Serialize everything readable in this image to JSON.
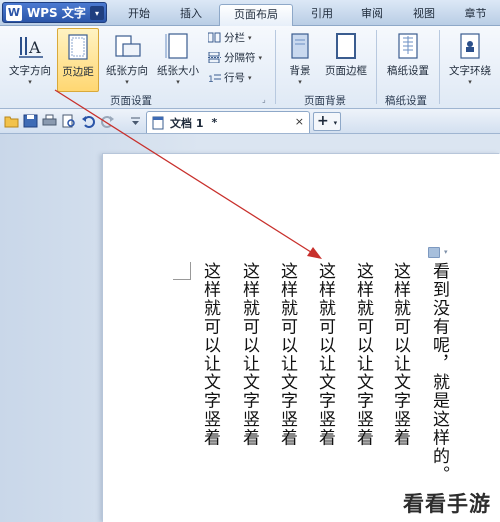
{
  "app": {
    "logo_text": "W",
    "name": "WPS 文字",
    "caret": "▾"
  },
  "tabs": [
    {
      "label": "开始"
    },
    {
      "label": "插入"
    },
    {
      "label": "页面布局"
    },
    {
      "label": "引用"
    },
    {
      "label": "审阅"
    },
    {
      "label": "视图"
    },
    {
      "label": "章节"
    }
  ],
  "active_tab": "页面布局",
  "ribbon": {
    "text_direction": "文字方向",
    "margins": "页边距",
    "orientation": "纸张方向",
    "paper_size": "纸张大小",
    "columns": "分栏",
    "breaks": "分隔符",
    "line_numbers": "行号",
    "background": "背景",
    "page_border": "页面边框",
    "manuscript_setup": "稿纸设置",
    "text_wrap": "文字环绕",
    "group_page_setup": "页面设置",
    "group_page_background": "页面背景",
    "group_manuscript": "稿纸设置",
    "caret": "▾"
  },
  "document_tab": {
    "name": "文档 1",
    "modified_mark": "*",
    "close": "×",
    "new_tab": "+",
    "new_tab_caret": "▾"
  },
  "document": {
    "columns": [
      "看到没有呢，就是这样的。",
      "这样就可以让文字竖着",
      "这样就可以让文字竖着",
      "这样就可以让文字竖着",
      "这样就可以让文字竖着",
      "这样就可以让文字竖着",
      "这样就可以让文字竖着"
    ]
  },
  "watermark": "看看手游网",
  "colors": {
    "arrow": "#c8302c",
    "active_highlight": "#ffd772"
  }
}
